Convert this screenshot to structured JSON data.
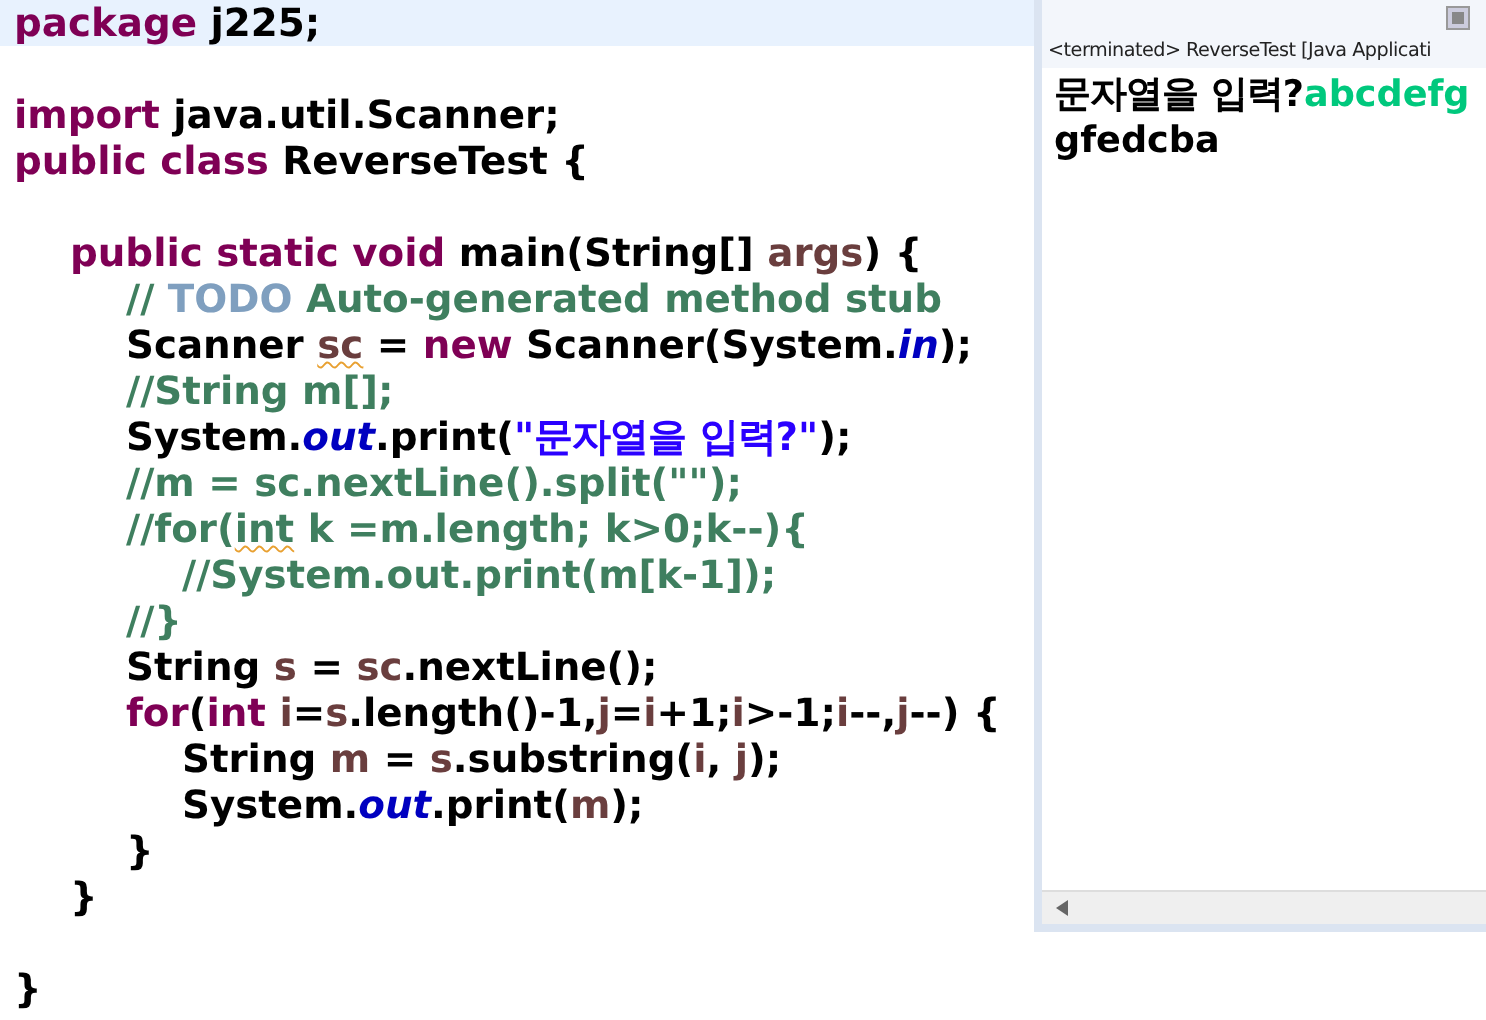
{
  "editor": {
    "lines": [
      {
        "current": true,
        "tokens": [
          {
            "kind": "keyword",
            "text": "package"
          },
          {
            "kind": "plain",
            "text": " j225;"
          }
        ]
      },
      {
        "current": false
      },
      {
        "current": false,
        "tokens": [
          {
            "kind": "keyword",
            "text": "import"
          },
          {
            "kind": "plain",
            "text": " java.util.Scanner;"
          }
        ]
      },
      {
        "current": false,
        "tokens": [
          {
            "kind": "keyword",
            "text": "public class"
          },
          {
            "kind": "plain",
            "text": " ReverseTest {"
          }
        ]
      },
      {
        "current": false
      },
      {
        "current": false,
        "tokens": [
          {
            "kind": "keyword",
            "text": "\tpublic static void"
          },
          {
            "kind": "plain",
            "text": " main(String[] "
          },
          {
            "kind": "local",
            "text": "args"
          },
          {
            "kind": "plain",
            "text": ") {"
          }
        ]
      },
      {
        "current": false,
        "tokens": [
          {
            "kind": "comment",
            "text": "\t\t// "
          },
          {
            "kind": "todo",
            "text": "TODO"
          },
          {
            "kind": "comment",
            "text": " Auto-generated method stub"
          }
        ]
      },
      {
        "current": false,
        "tokens": [
          {
            "kind": "plain",
            "text": "\t\tScanner "
          },
          {
            "kind": "local",
            "text": "sc",
            "warning": true
          },
          {
            "kind": "plain",
            "text": " = "
          },
          {
            "kind": "keyword",
            "text": "new"
          },
          {
            "kind": "plain",
            "text": " Scanner(System."
          },
          {
            "kind": "field",
            "text": "in"
          },
          {
            "kind": "plain",
            "text": ");"
          }
        ]
      },
      {
        "current": false,
        "tokens": [
          {
            "kind": "comment",
            "text": "\t\t//String m[];"
          }
        ]
      },
      {
        "current": false,
        "tokens": [
          {
            "kind": "plain",
            "text": "\t\tSystem."
          },
          {
            "kind": "field",
            "text": "out"
          },
          {
            "kind": "plain",
            "text": ".print("
          },
          {
            "kind": "string",
            "text": "\"문자열을 입력?\""
          },
          {
            "kind": "plain",
            "text": ");"
          }
        ]
      },
      {
        "current": false,
        "tokens": [
          {
            "kind": "comment",
            "text": "\t\t//m = sc.nextLine().split(\"\");"
          }
        ]
      },
      {
        "current": false,
        "tokens": [
          {
            "kind": "comment",
            "text": "\t\t//for("
          },
          {
            "kind": "comment",
            "text": "int",
            "warning": true
          },
          {
            "kind": "comment",
            "text": " k =m.length; k>0;k--){"
          }
        ]
      },
      {
        "current": false,
        "tokens": [
          {
            "kind": "comment",
            "text": "\t\t\t//System.out.print(m[k-1]);"
          }
        ]
      },
      {
        "current": false,
        "tokens": [
          {
            "kind": "comment",
            "text": "\t\t//}"
          }
        ]
      },
      {
        "current": false,
        "tokens": [
          {
            "kind": "plain",
            "text": "\t\tString "
          },
          {
            "kind": "local",
            "text": "s"
          },
          {
            "kind": "plain",
            "text": " = "
          },
          {
            "kind": "local",
            "text": "sc"
          },
          {
            "kind": "plain",
            "text": ".nextLine();"
          }
        ]
      },
      {
        "current": false,
        "tokens": [
          {
            "kind": "keyword",
            "text": "\t\tfor"
          },
          {
            "kind": "plain",
            "text": "("
          },
          {
            "kind": "keyword",
            "text": "int "
          },
          {
            "kind": "local",
            "text": "i"
          },
          {
            "kind": "plain",
            "text": "="
          },
          {
            "kind": "local",
            "text": "s"
          },
          {
            "kind": "plain",
            "text": ".length()-1,"
          },
          {
            "kind": "local",
            "text": "j"
          },
          {
            "kind": "plain",
            "text": "="
          },
          {
            "kind": "local",
            "text": "i"
          },
          {
            "kind": "plain",
            "text": "+1;"
          },
          {
            "kind": "local",
            "text": "i"
          },
          {
            "kind": "plain",
            "text": ">-1;"
          },
          {
            "kind": "local",
            "text": "i"
          },
          {
            "kind": "plain",
            "text": "--,"
          },
          {
            "kind": "local",
            "text": "j"
          },
          {
            "kind": "plain",
            "text": "--) {"
          }
        ]
      },
      {
        "current": false,
        "tokens": [
          {
            "kind": "plain",
            "text": "\t\t\tString "
          },
          {
            "kind": "local",
            "text": "m"
          },
          {
            "kind": "plain",
            "text": " = "
          },
          {
            "kind": "local",
            "text": "s"
          },
          {
            "kind": "plain",
            "text": ".substring("
          },
          {
            "kind": "local",
            "text": "i"
          },
          {
            "kind": "plain",
            "text": ", "
          },
          {
            "kind": "local",
            "text": "j"
          },
          {
            "kind": "plain",
            "text": ");"
          }
        ]
      },
      {
        "current": false,
        "tokens": [
          {
            "kind": "plain",
            "text": "\t\t\tSystem."
          },
          {
            "kind": "field",
            "text": "out"
          },
          {
            "kind": "plain",
            "text": ".print("
          },
          {
            "kind": "local",
            "text": "m"
          },
          {
            "kind": "plain",
            "text": ");"
          }
        ]
      },
      {
        "current": false,
        "tokens": [
          {
            "kind": "plain",
            "text": "\t\t}"
          }
        ]
      },
      {
        "current": false,
        "tokens": [
          {
            "kind": "plain",
            "text": "\t}"
          }
        ]
      },
      {
        "current": false
      },
      {
        "current": false,
        "tokens": [
          {
            "kind": "plain",
            "text": "}"
          }
        ]
      }
    ]
  },
  "console": {
    "header": "<terminated> ReverseTest [Java Applicati",
    "lines": [
      [
        {
          "kind": "output",
          "text": "문자열을 입력?"
        },
        {
          "kind": "input",
          "text": "abcdefg"
        }
      ],
      [
        {
          "kind": "output",
          "text": "gfedcba"
        }
      ]
    ]
  }
}
